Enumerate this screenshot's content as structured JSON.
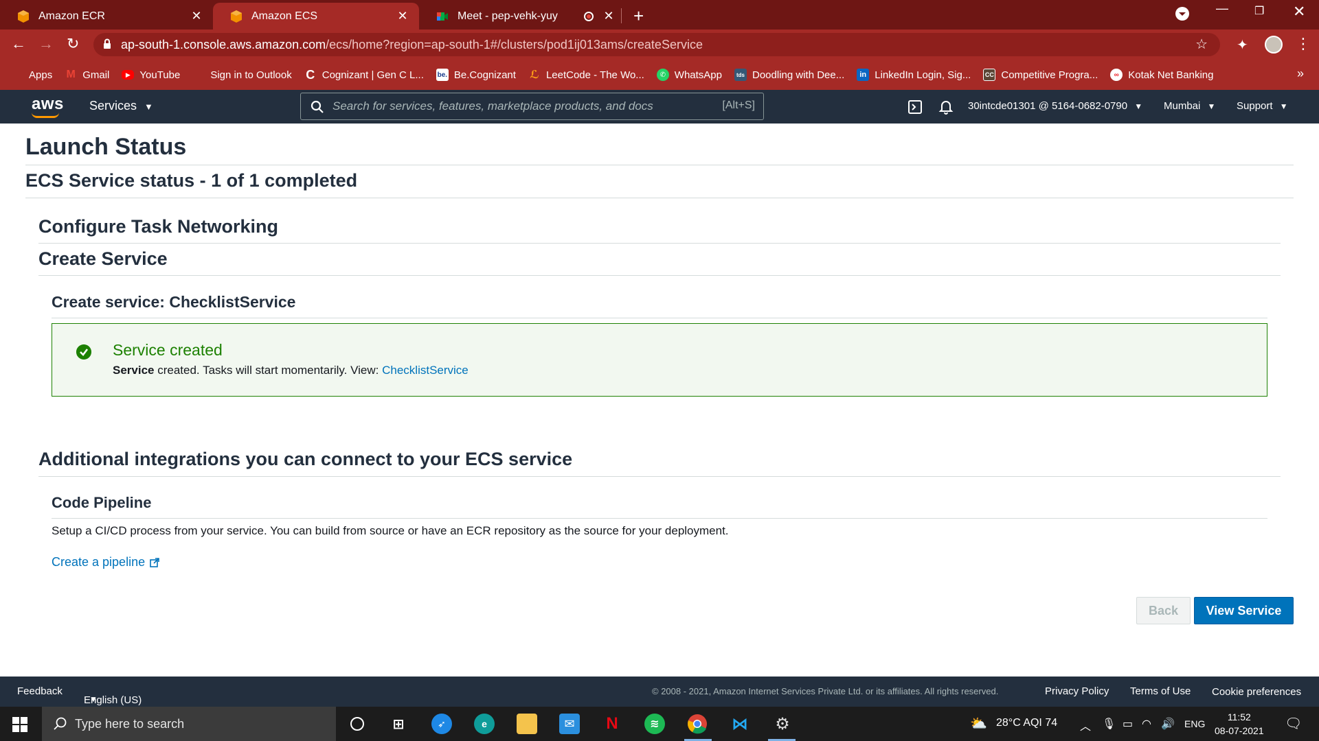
{
  "browser": {
    "tabs": [
      {
        "title": "Amazon ECR",
        "icon": "aws-orange-cube-icon"
      },
      {
        "title": "Amazon ECS",
        "icon": "aws-orange-cube-icon",
        "active": true
      },
      {
        "title": "Meet - pep-vehk-yuy",
        "icon": "google-meet-icon",
        "recording": true
      }
    ],
    "url_host": "ap-south-1.console.aws.amazon.com",
    "url_path": "/ecs/home?region=ap-south-1#/clusters/pod1ij013ams/createService",
    "bookmarks": [
      {
        "label": "Apps",
        "icon": "apps-grid-icon"
      },
      {
        "label": "Gmail",
        "icon": "gmail-icon"
      },
      {
        "label": "YouTube",
        "icon": "youtube-icon"
      },
      {
        "label": "Sign in to Outlook",
        "icon": "microsoft-icon"
      },
      {
        "label": "Cognizant | Gen C L...",
        "icon": "cognizant-icon"
      },
      {
        "label": "Be.Cognizant",
        "icon": "be-cognizant-icon"
      },
      {
        "label": "LeetCode - The Wo...",
        "icon": "leetcode-icon"
      },
      {
        "label": "WhatsApp",
        "icon": "whatsapp-icon"
      },
      {
        "label": "Doodling with Dee...",
        "icon": "tds-icon"
      },
      {
        "label": "LinkedIn Login, Sig...",
        "icon": "linkedin-icon"
      },
      {
        "label": "Competitive Progra...",
        "icon": "cc-icon"
      },
      {
        "label": "Kotak Net Banking",
        "icon": "kotak-icon"
      }
    ],
    "bookmarks_more": "»"
  },
  "aws_nav": {
    "logo": "aws",
    "services_label": "Services",
    "search_placeholder": "Search for services, features, marketplace products, and docs",
    "search_shortcut": "[Alt+S]",
    "account": "30intcde01301 @ 5164-0682-0790",
    "region": "Mumbai",
    "support": "Support"
  },
  "page": {
    "title": "Launch Status",
    "status": "ECS Service status - 1 of 1 completed",
    "section_networking": "Configure Task Networking",
    "section_create": "Create Service",
    "create_service_label": "Create service: ChecklistService",
    "success": {
      "title": "Service created",
      "msg_bold": "Service",
      "msg_rest": " created. Tasks will start momentarily. View: ",
      "link": "ChecklistService",
      "color": "#1d8102"
    },
    "integrations_title": "Additional integrations you can connect to your ECS service",
    "pipeline_title": "Code Pipeline",
    "pipeline_desc": "Setup a CI/CD process from your service. You can build from source or have an ECR repository as the source for your deployment.",
    "pipeline_link": "Create a pipeline",
    "back_label": "Back",
    "view_label": "View Service",
    "primary_color": "#0073bb"
  },
  "footer": {
    "feedback": "Feedback",
    "language": "English (US)",
    "copyright": "© 2008 - 2021, Amazon Internet Services Private Ltd. or its affiliates. All rights reserved.",
    "privacy": "Privacy Policy",
    "terms": "Terms of Use",
    "cookies": "Cookie preferences"
  },
  "taskbar": {
    "search_placeholder": "Type here to search",
    "weather": "28°C  AQI 74",
    "lang": "ENG",
    "time": "11:52",
    "date": "08-07-2021"
  }
}
